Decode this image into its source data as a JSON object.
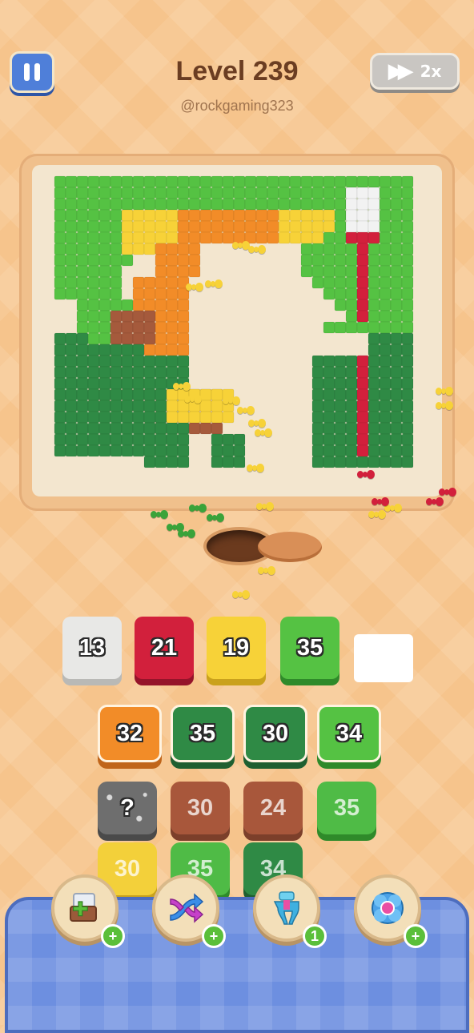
{
  "header": {
    "level_title": "Level 239",
    "username": "@rockgaming323",
    "speed_label": "2x"
  },
  "colors": {
    "green": "#55c243",
    "dark_green": "#2f8a45",
    "yellow": "#f7d238",
    "orange": "#f28c28",
    "brown": "#a55a3c",
    "red": "#d2203c",
    "white": "#f2f2f2"
  },
  "queue_slots": [
    {
      "value": "13",
      "color": "white"
    },
    {
      "value": "21",
      "color": "red"
    },
    {
      "value": "19",
      "color": "yellow"
    },
    {
      "value": "35",
      "color": "green"
    },
    {
      "value": "",
      "color": "empty"
    }
  ],
  "tile_grid": [
    {
      "value": "32",
      "color": "orange",
      "state": "active"
    },
    {
      "value": "35",
      "color": "dark_green",
      "state": "active"
    },
    {
      "value": "30",
      "color": "dark_green",
      "state": "active"
    },
    {
      "value": "34",
      "color": "green",
      "state": "active"
    },
    {
      "value": "?",
      "color": "mystery",
      "state": "locked"
    },
    {
      "value": "30",
      "color": "brown",
      "state": "inactive"
    },
    {
      "value": "24",
      "color": "brown",
      "state": "inactive"
    },
    {
      "value": "35",
      "color": "green",
      "state": "inactive"
    },
    {
      "value": "30",
      "color": "yellow",
      "state": "inactive"
    },
    {
      "value": "35",
      "color": "green",
      "state": "inactive"
    },
    {
      "value": "34",
      "color": "dark_green",
      "state": "inactive"
    }
  ],
  "tools": [
    {
      "name": "add-tray-tool",
      "badge": "+"
    },
    {
      "name": "shuffle-tool",
      "badge": "+"
    },
    {
      "name": "magnet-claw-tool",
      "badge": "1"
    },
    {
      "name": "rotate-tool",
      "badge": "+"
    }
  ]
}
